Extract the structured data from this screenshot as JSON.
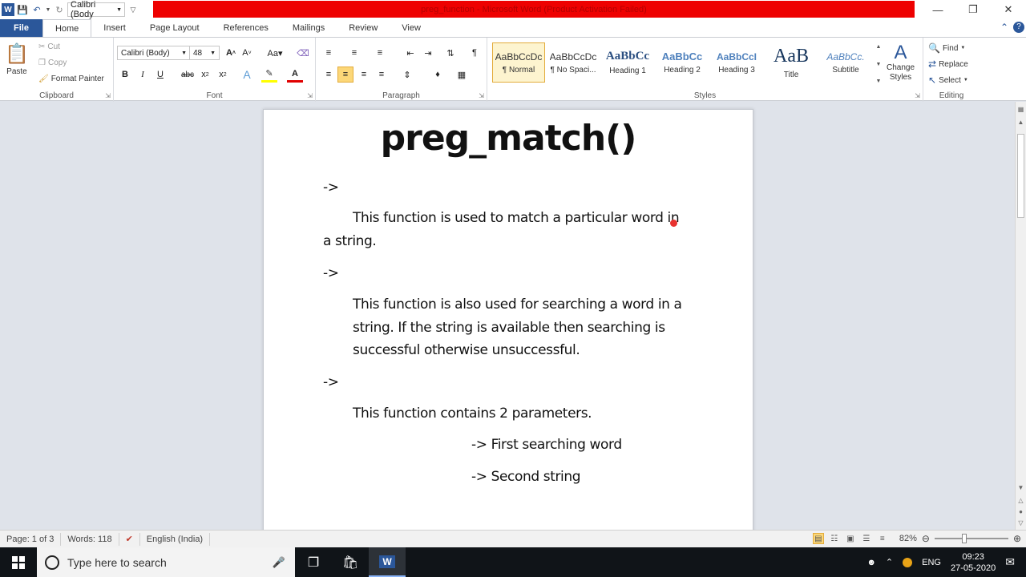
{
  "window": {
    "title": "preg_function - Microsoft Word (Product Activation Failed)",
    "qat_font": "Calibri (Body"
  },
  "tabs": [
    "File",
    "Home",
    "Insert",
    "Page Layout",
    "References",
    "Mailings",
    "Review",
    "View"
  ],
  "ribbon": {
    "clipboard": {
      "label": "Clipboard",
      "paste": "Paste",
      "cut": "Cut",
      "copy": "Copy",
      "format_painter": "Format Painter"
    },
    "font": {
      "label": "Font",
      "font_name": "Calibri (Body)",
      "font_size": "48"
    },
    "paragraph": {
      "label": "Paragraph"
    },
    "styles": {
      "label": "Styles",
      "items": [
        {
          "sample": "AaBbCcDc",
          "name": "¶ Normal"
        },
        {
          "sample": "AaBbCcDc",
          "name": "¶ No Spaci..."
        },
        {
          "sample": "AaBbCc",
          "name": "Heading 1"
        },
        {
          "sample": "AaBbCc",
          "name": "Heading 2"
        },
        {
          "sample": "AaBbCcI",
          "name": "Heading 3"
        },
        {
          "sample": "AaB",
          "name": "Title"
        },
        {
          "sample": "AaBbCc.",
          "name": "Subtitle"
        }
      ],
      "change_styles_1": "Change",
      "change_styles_2": "Styles"
    },
    "editing": {
      "label": "Editing",
      "find": "Find",
      "replace": "Replace",
      "select": "Select"
    }
  },
  "document": {
    "title": "preg_match()",
    "arrow1": "->",
    "para1_line1": "This function is used to match a particular word in",
    "para1_line2": "a string.",
    "arrow2": "->",
    "para2_line1": "This function is also used for searching a word in a",
    "para2_line2": "string. If the string is available then searching is",
    "para2_line3": "successful otherwise unsuccessful.",
    "arrow3": "->",
    "para3": "This function contains 2 parameters.",
    "param1": "-> First searching word",
    "param2": "-> Second string"
  },
  "status": {
    "page": "Page: 1 of 3",
    "words": "Words: 118",
    "language": "English (India)",
    "zoom": "82%"
  },
  "taskbar": {
    "search_placeholder": "Type here to search",
    "lang": "ENG",
    "time": "09:23",
    "date": "27-05-2020"
  },
  "colors": {
    "accent": "#2b579a",
    "title_bar_red": "#ee0000",
    "selected_gold": "#fcd778"
  }
}
